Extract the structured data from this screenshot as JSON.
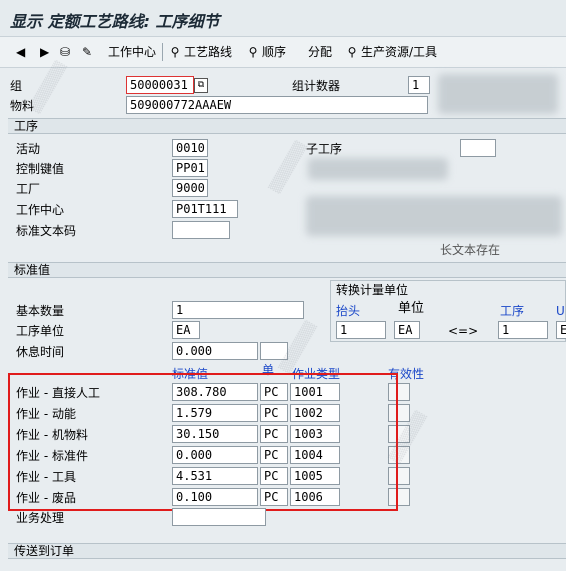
{
  "window": {
    "title": "显示 定额工艺路线: 工序细节"
  },
  "toolbar": {
    "work_center": "工作中心",
    "routing": "工艺路线",
    "sequence": "顺序",
    "allocation": "分配",
    "prt": "生产资源/工具"
  },
  "header": {
    "group_label": "组",
    "group_value": "50000031",
    "counter_label": "组计数器",
    "counter_value": "1",
    "material_label": "物料",
    "material_value": "509000772AAAEW"
  },
  "operation": {
    "section_title": "工序",
    "activity_label": "活动",
    "activity_value": "0010",
    "suboperation_label": "子工序",
    "control_key_label": "控制键值",
    "control_key_value": "PP01",
    "plant_label": "工厂",
    "plant_value": "9000",
    "work_center_label": "工作中心",
    "work_center_value": "P01T111",
    "std_text_label": "标准文本码",
    "long_text_note": "长文本存在"
  },
  "standard_values": {
    "section_title": "标准值",
    "base_qty_label": "基本数量",
    "base_qty_value": "1",
    "op_unit_label": "工序单位",
    "op_unit_value": "EA",
    "break_label": "休息时间",
    "break_value": "0.000",
    "col_std_value": "标准值",
    "col_unit": "单",
    "col_activity_type": "作业类型",
    "col_valid": "有效性",
    "rows": [
      {
        "label": "作业 - 直接人工",
        "value": "308.780",
        "unit": "PC",
        "type": "1001"
      },
      {
        "label": "作业 - 动能",
        "value": "1.579",
        "unit": "PC",
        "type": "1002"
      },
      {
        "label": "作业 - 机物料",
        "value": "30.150",
        "unit": "PC",
        "type": "1003"
      },
      {
        "label": "作业 - 标准件",
        "value": "0.000",
        "unit": "PC",
        "type": "1004"
      },
      {
        "label": "作业 - 工具",
        "value": "4.531",
        "unit": "PC",
        "type": "1005"
      },
      {
        "label": "作业 - 废品",
        "value": "0.100",
        "unit": "PC",
        "type": "1006"
      }
    ],
    "business_label": "业务处理"
  },
  "conversion": {
    "title": "转换计量单位",
    "header_label": "抬头",
    "unit_label": "单位",
    "operation_label": "工序",
    "cut_label": "U",
    "header_value": "1",
    "unit_value": "EA",
    "arrow": "<=>",
    "operation_value": "1",
    "cut_value": "E"
  },
  "footer": {
    "transfer_label": "传送到订单"
  },
  "colors": {
    "accent_blue": "#1a47c8",
    "annotation_red": "#e01b1b",
    "background": "#e8edf0"
  }
}
